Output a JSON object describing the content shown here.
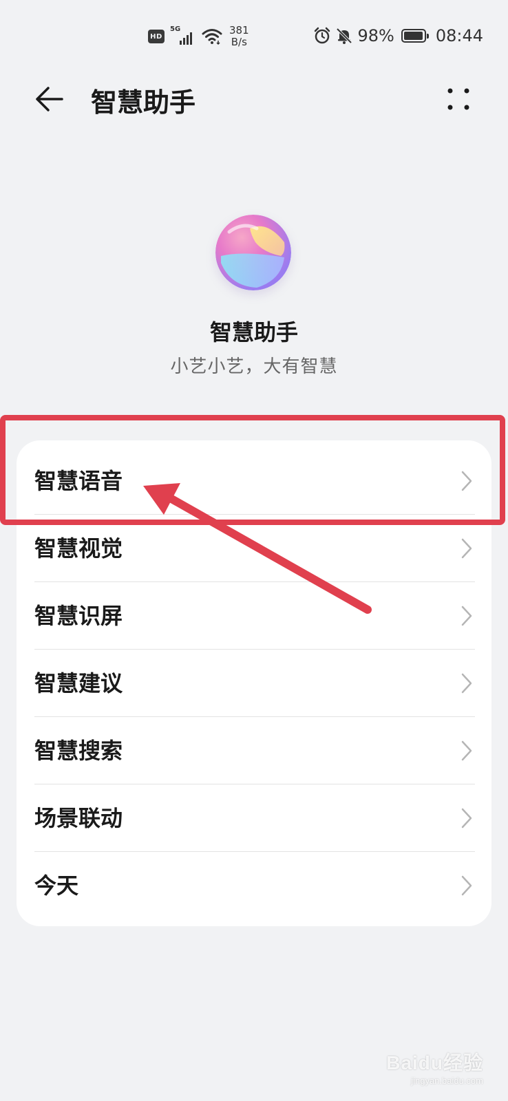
{
  "status_bar": {
    "hd": "HD",
    "signal_type": "5G",
    "net_speed_value": "381",
    "net_speed_unit": "B/s",
    "battery_percent": "98%",
    "battery_level": 0.98,
    "time": "08:44",
    "icons": [
      "hd-icon",
      "signal-icon",
      "wifi-icon",
      "alarm-icon",
      "mute-bell-icon",
      "battery-icon"
    ]
  },
  "header": {
    "title": "智慧助手",
    "back_icon": "back-arrow-icon",
    "more_icon": "more-dots-icon"
  },
  "hero": {
    "name": "智慧助手",
    "slogan": "小艺小艺，大有智慧",
    "logo_icon": "celia-orb-icon"
  },
  "menu": {
    "items": [
      {
        "label": "智慧语音"
      },
      {
        "label": "智慧视觉"
      },
      {
        "label": "智慧识屏"
      },
      {
        "label": "智慧建议"
      },
      {
        "label": "智慧搜索"
      },
      {
        "label": "场景联动"
      },
      {
        "label": "今天"
      }
    ]
  },
  "annotation": {
    "color": "#e0404e",
    "highlighted_item": "智慧语音"
  },
  "watermark": {
    "logo": "Baidu经验",
    "url": "jingyan.baidu.com"
  },
  "colors": {
    "background": "#f1f2f4",
    "card": "#ffffff",
    "text_primary": "#1a1a1a",
    "text_secondary": "#666666",
    "chevron": "#b5b5b5"
  }
}
